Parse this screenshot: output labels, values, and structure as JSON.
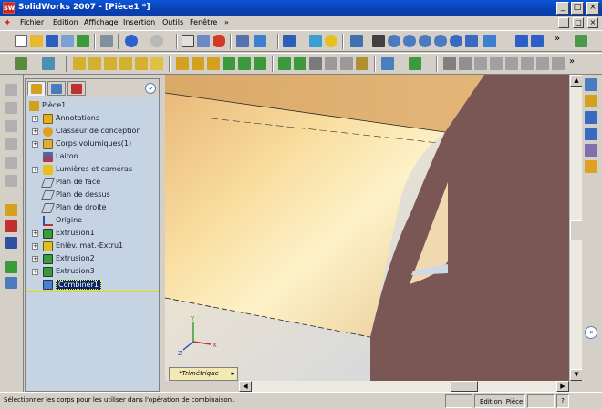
{
  "window": {
    "title": "SolidWorks 2007 - [Pièce1 *]",
    "app_icon": "sw",
    "minimize": "_",
    "restore": "□",
    "close": "×"
  },
  "menu": {
    "items": [
      "Fichier",
      "Edition",
      "Affichage",
      "Insertion",
      "Outils",
      "Fenêtre"
    ],
    "more": "»",
    "mdi_min": "_",
    "mdi_restore": "□",
    "mdi_close": "×"
  },
  "toolbar": {
    "more": "»"
  },
  "panel": {
    "tabs": [
      "feature-manager-tab",
      "property-manager-tab",
      "configuration-manager-tab"
    ],
    "collapse": "»",
    "tree": [
      {
        "label": "Pièce1",
        "icon": "part-icon",
        "expander": ""
      },
      {
        "label": "Annotations",
        "icon": "annotations-icon",
        "expander": "+"
      },
      {
        "label": "Classeur de conception",
        "icon": "design-binder-icon",
        "expander": "+"
      },
      {
        "label": "Corps volumiques(1)",
        "icon": "solid-bodies-icon",
        "expander": "+"
      },
      {
        "label": "Laiton",
        "icon": "material-icon",
        "expander": ""
      },
      {
        "label": "Lumières et caméras",
        "icon": "lights-cameras-icon",
        "expander": "+"
      },
      {
        "label": "Plan de face",
        "icon": "plane-icon",
        "expander": ""
      },
      {
        "label": "Plan de dessus",
        "icon": "plane-icon",
        "expander": ""
      },
      {
        "label": "Plan de droite",
        "icon": "plane-icon",
        "expander": ""
      },
      {
        "label": "Origine",
        "icon": "origin-icon",
        "expander": ""
      },
      {
        "label": "Extrusion1",
        "icon": "extrude-icon",
        "expander": "+"
      },
      {
        "label": "Enlèv. mat.-Extru1",
        "icon": "cut-extrude-icon",
        "expander": "+"
      },
      {
        "label": "Extrusion2",
        "icon": "extrude-icon",
        "expander": "+"
      },
      {
        "label": "Extrusion3",
        "icon": "extrude-icon",
        "expander": "+"
      },
      {
        "label": "Combiner1",
        "icon": "combine-icon",
        "expander": "",
        "selected": true
      }
    ]
  },
  "viewport": {
    "view_name": "*Trimétrique",
    "view_arrow": "▸",
    "triad": {
      "x": "X",
      "y": "Y",
      "z": "Z"
    }
  },
  "scroll": {
    "up": "▲",
    "down": "▼",
    "left": "◀",
    "right": "▶",
    "expand": "«"
  },
  "status": {
    "message": "Sélectionner les corps pour les utiliser dans l'opération de combinaison.",
    "mode": "Edition: Pièce",
    "help": "?"
  },
  "colors": {
    "model_face": "#f3d79a",
    "model_side": "#7a5655",
    "selection": "#0a246a",
    "titlebar": "#0b3fb0"
  }
}
